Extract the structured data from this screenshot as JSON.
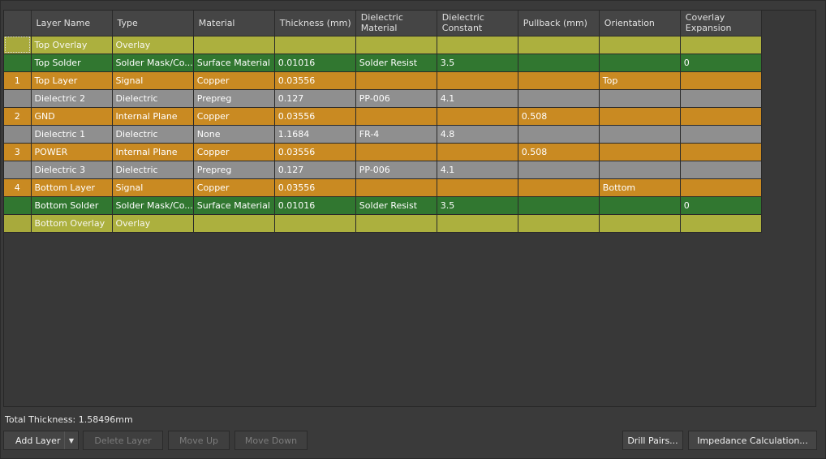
{
  "columns": [
    "",
    "Layer Name",
    "Type",
    "Material",
    "Thickness (mm)",
    "Dielectric Material",
    "Dielectric Constant",
    "Pullback (mm)",
    "Orientation",
    "Coverlay Expansion"
  ],
  "rows": [
    {
      "kind": "overlay",
      "num": "",
      "name": "Top Overlay",
      "type": "Overlay",
      "material": "",
      "thickness": "",
      "diel_material": "",
      "diel_constant": "",
      "pullback": "",
      "orientation": "",
      "coverlay": ""
    },
    {
      "kind": "solder",
      "num": "",
      "name": "Top Solder",
      "type": "Solder Mask/Co...",
      "material": "Surface Material",
      "thickness": "0.01016",
      "diel_material": "Solder Resist",
      "diel_constant": "3.5",
      "pullback": "",
      "orientation": "",
      "coverlay": "0"
    },
    {
      "kind": "signal",
      "num": "1",
      "name": "Top Layer",
      "type": "Signal",
      "material": "Copper",
      "thickness": "0.03556",
      "diel_material": "",
      "diel_constant": "",
      "pullback": "",
      "orientation": "Top",
      "coverlay": ""
    },
    {
      "kind": "dielectric",
      "num": "",
      "name": "Dielectric 2",
      "type": "Dielectric",
      "material": "Prepreg",
      "thickness": "0.127",
      "diel_material": "PP-006",
      "diel_constant": "4.1",
      "pullback": "",
      "orientation": "",
      "coverlay": ""
    },
    {
      "kind": "plane",
      "num": "2",
      "name": "GND",
      "type": "Internal Plane",
      "material": "Copper",
      "thickness": "0.03556",
      "diel_material": "",
      "diel_constant": "",
      "pullback": "0.508",
      "orientation": "",
      "coverlay": ""
    },
    {
      "kind": "dielectric",
      "num": "",
      "name": "Dielectric 1",
      "type": "Dielectric",
      "material": "None",
      "thickness": "1.1684",
      "diel_material": "FR-4",
      "diel_constant": "4.8",
      "pullback": "",
      "orientation": "",
      "coverlay": ""
    },
    {
      "kind": "plane",
      "num": "3",
      "name": "POWER",
      "type": "Internal Plane",
      "material": "Copper",
      "thickness": "0.03556",
      "diel_material": "",
      "diel_constant": "",
      "pullback": "0.508",
      "orientation": "",
      "coverlay": ""
    },
    {
      "kind": "dielectric",
      "num": "",
      "name": "Dielectric 3",
      "type": "Dielectric",
      "material": "Prepreg",
      "thickness": "0.127",
      "diel_material": "PP-006",
      "diel_constant": "4.1",
      "pullback": "",
      "orientation": "",
      "coverlay": ""
    },
    {
      "kind": "signal",
      "num": "4",
      "name": "Bottom Layer",
      "type": "Signal",
      "material": "Copper",
      "thickness": "0.03556",
      "diel_material": "",
      "diel_constant": "",
      "pullback": "",
      "orientation": "Bottom",
      "coverlay": ""
    },
    {
      "kind": "solder",
      "num": "",
      "name": "Bottom Solder",
      "type": "Solder Mask/Co...",
      "material": "Surface Material",
      "thickness": "0.01016",
      "diel_material": "Solder Resist",
      "diel_constant": "3.5",
      "pullback": "",
      "orientation": "",
      "coverlay": "0"
    },
    {
      "kind": "overlay",
      "num": "",
      "name": "Bottom Overlay",
      "type": "Overlay",
      "material": "",
      "thickness": "",
      "diel_material": "",
      "diel_constant": "",
      "pullback": "",
      "orientation": "",
      "coverlay": ""
    }
  ],
  "total_thickness": "Total Thickness: 1.58496mm",
  "buttons": {
    "add_layer": "Add Layer",
    "delete_layer": "Delete Layer",
    "move_up": "Move Up",
    "move_down": "Move Down",
    "drill_pairs": "Drill Pairs...",
    "impedance": "Impedance Calculation..."
  },
  "icons": {
    "dropdown": "chevron-down-icon"
  },
  "colors": {
    "overlay": "#acb03e",
    "solder": "#317730",
    "copper": "#c98a22",
    "dielectric": "#8f8f8f",
    "background": "#3a3a3a"
  }
}
